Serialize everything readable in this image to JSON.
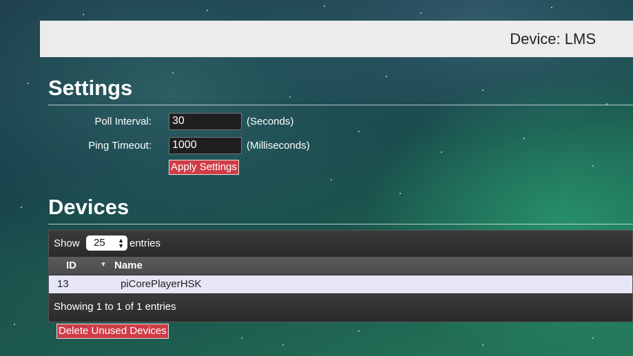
{
  "header": {
    "title": "Device: LMS"
  },
  "settings": {
    "title": "Settings",
    "poll_interval": {
      "label": "Poll Interval:",
      "value": "30",
      "unit": "(Seconds)"
    },
    "ping_timeout": {
      "label": "Ping Timeout:",
      "value": "1000",
      "unit": "(Milliseconds)"
    },
    "apply_label": "Apply Settings"
  },
  "devices": {
    "title": "Devices",
    "length_menu": {
      "show_label": "Show",
      "selected": "25",
      "entries_label": "entries"
    },
    "columns": [
      "ID",
      "Name"
    ],
    "rows": [
      {
        "id": "13",
        "name": "piCorePlayerHSK"
      }
    ],
    "info": "Showing 1 to 1 of 1 entries",
    "delete_label": "Delete Unused Devices"
  },
  "colors": {
    "accent_red": "#cf3c46",
    "row_highlight": "#e6e6f7"
  }
}
